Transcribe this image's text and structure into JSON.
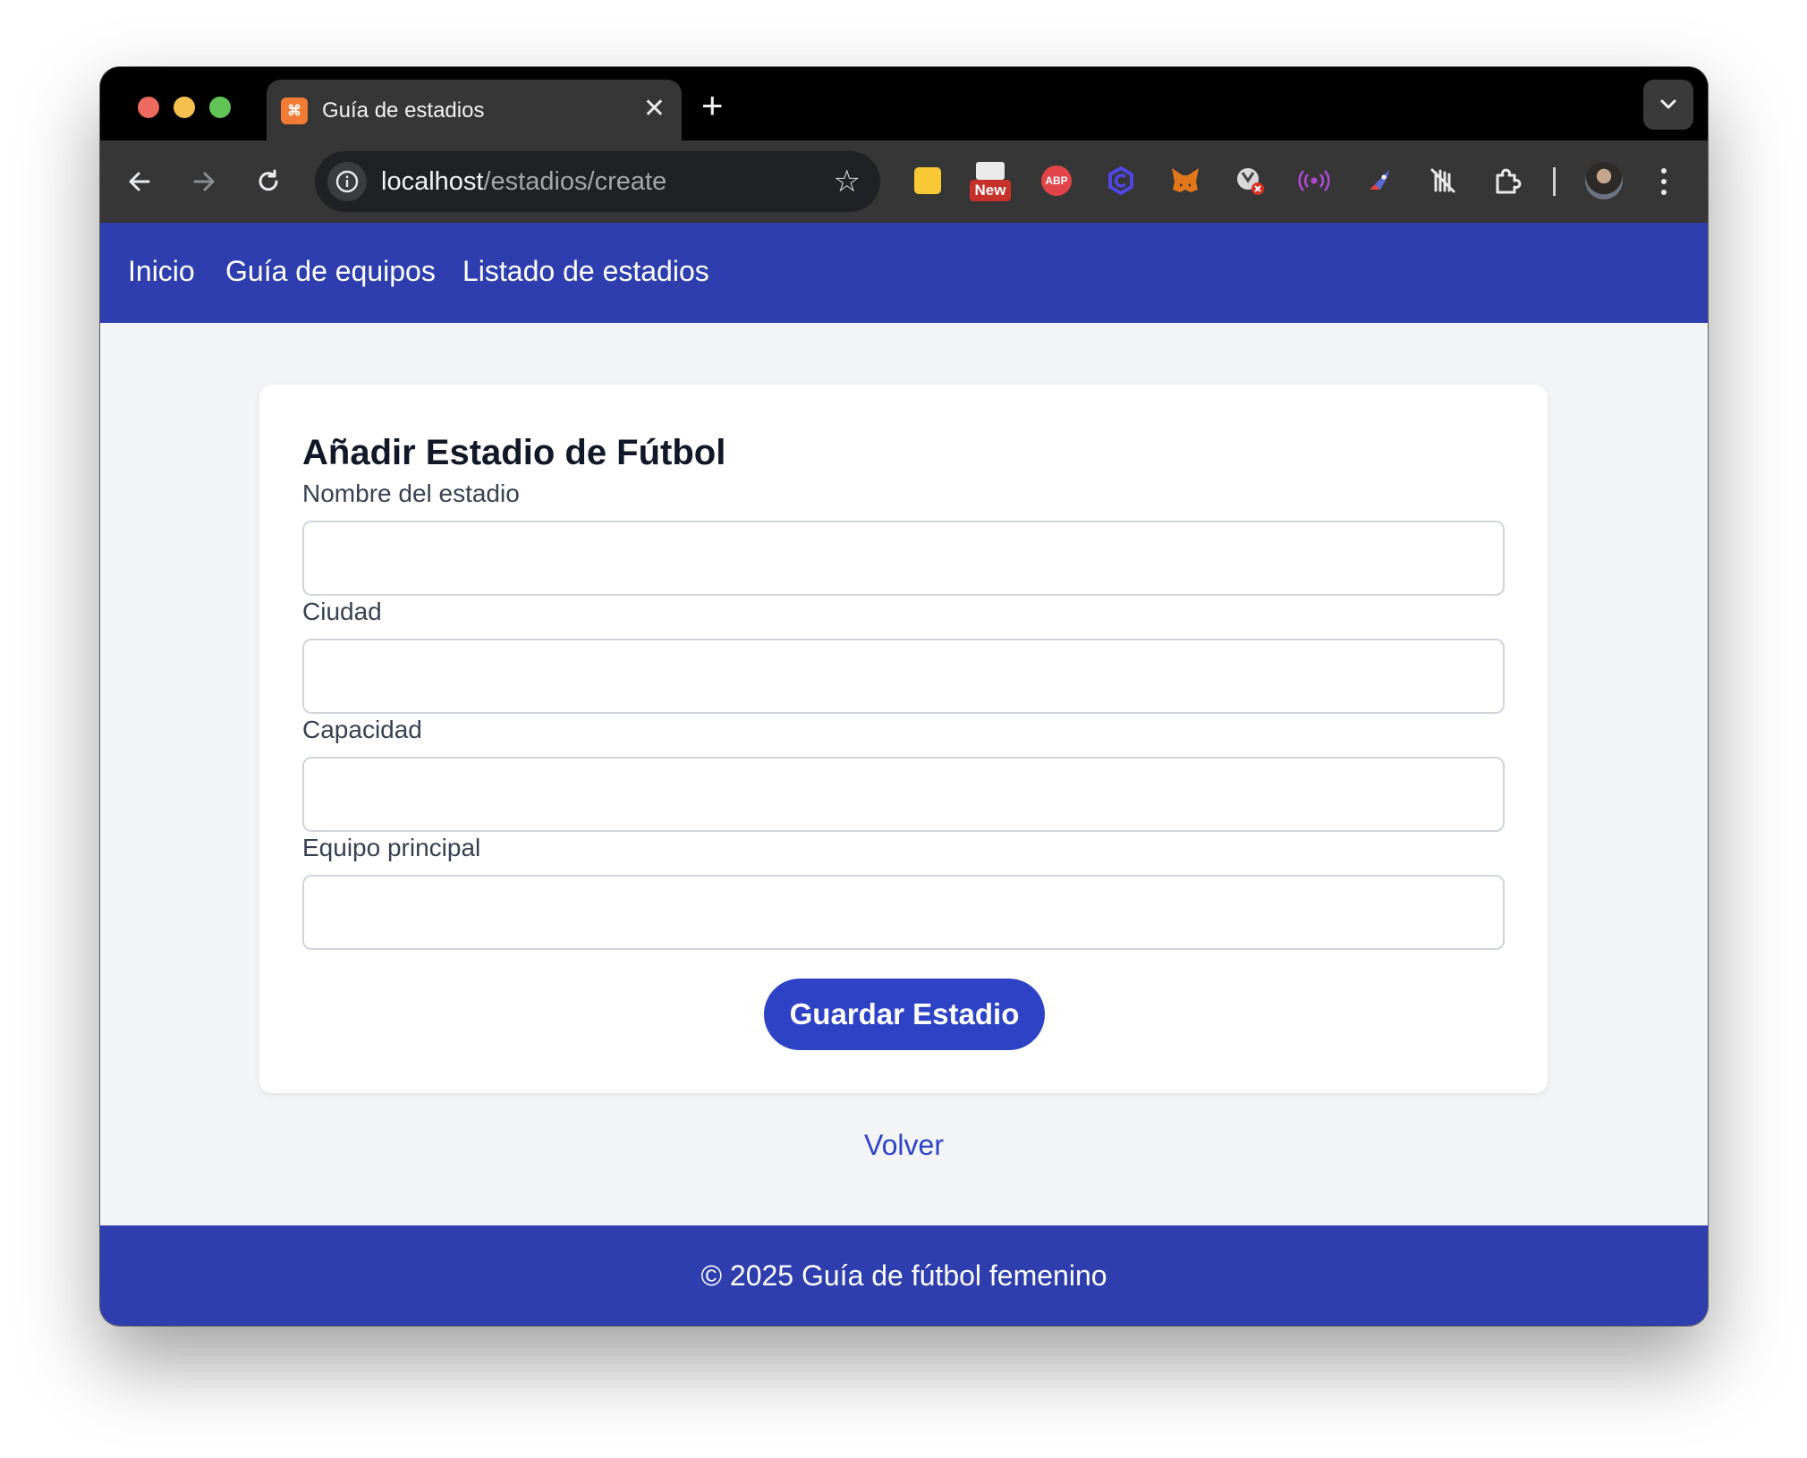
{
  "browser": {
    "tab_title": "Guía de estadios",
    "tab_close": "✕",
    "new_tab": "+",
    "url_host": "localhost",
    "url_path": "/estadios/create",
    "extension_new_label": "New",
    "extension_abp_label": "ABP"
  },
  "nav": {
    "links": [
      "Inicio",
      "Guía de equipos",
      "Listado de estadios"
    ]
  },
  "form": {
    "title": "Añadir Estadio de Fútbol",
    "fields": [
      {
        "label": "Nombre del estadio",
        "value": ""
      },
      {
        "label": "Ciudad",
        "value": ""
      },
      {
        "label": "Capacidad",
        "value": ""
      },
      {
        "label": "Equipo principal",
        "value": ""
      }
    ],
    "submit_label": "Guardar Estadio"
  },
  "back_link": "Volver",
  "footer": {
    "text": "© 2025 Guía de fútbol femenino"
  },
  "colors": {
    "nav_bg": "#2e3eae",
    "button_bg": "#2e42c6",
    "page_bg": "#f3f4f6"
  }
}
